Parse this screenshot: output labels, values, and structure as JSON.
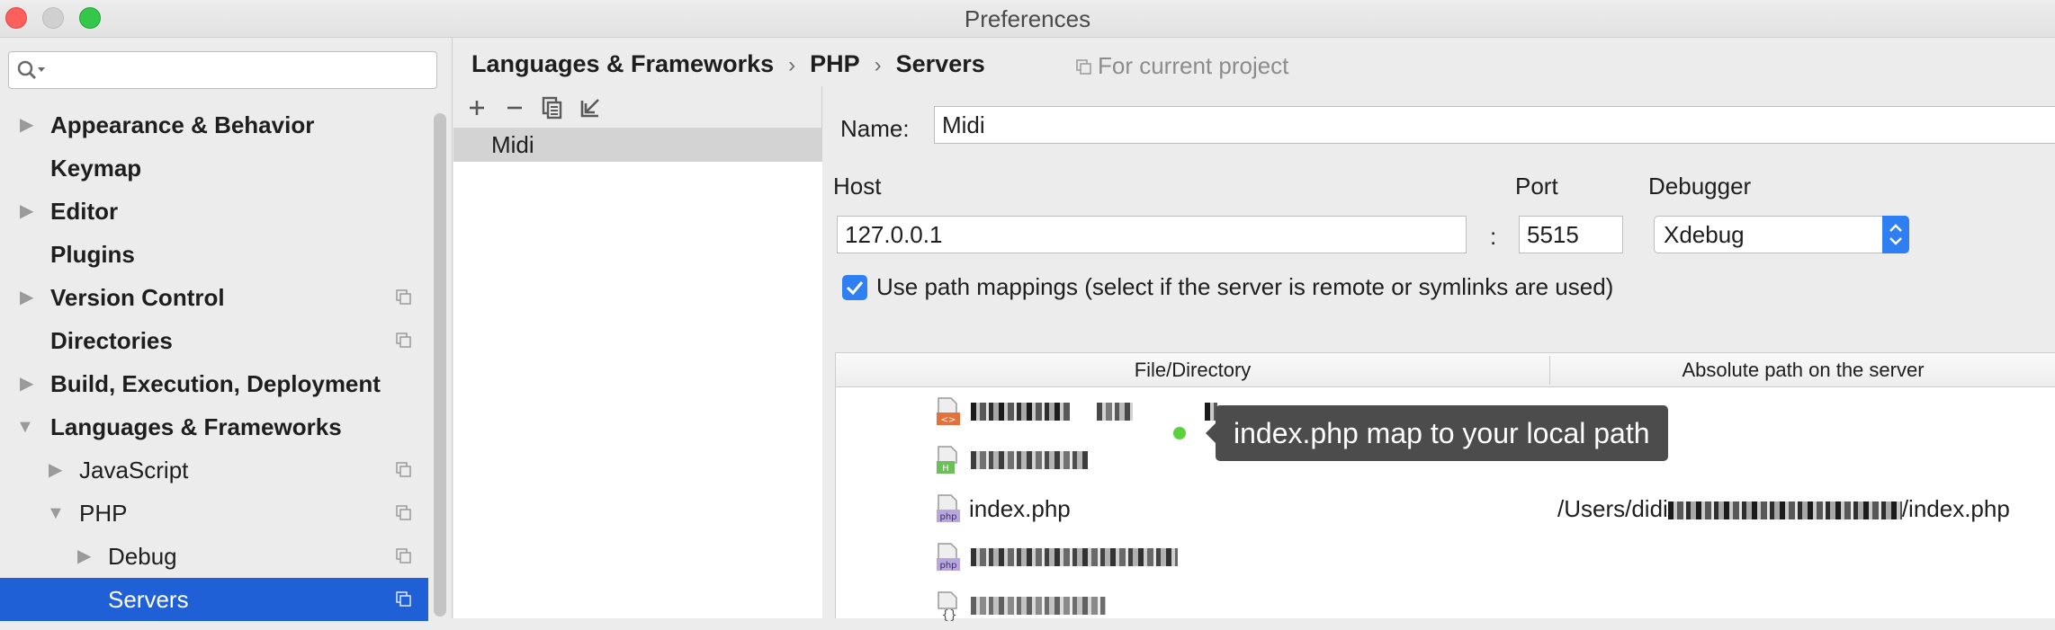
{
  "window": {
    "title": "Preferences"
  },
  "search": {
    "placeholder": ""
  },
  "sidebar": {
    "items": [
      {
        "label": "Appearance & Behavior",
        "arrow": "▶",
        "bold": true
      },
      {
        "label": "Keymap",
        "arrow": "",
        "bold": true
      },
      {
        "label": "Editor",
        "arrow": "▶",
        "bold": true
      },
      {
        "label": "Plugins",
        "arrow": "",
        "bold": true
      },
      {
        "label": "Version Control",
        "arrow": "▶",
        "bold": true,
        "project": true
      },
      {
        "label": "Directories",
        "arrow": "",
        "bold": true,
        "project": true
      },
      {
        "label": "Build, Execution, Deployment",
        "arrow": "▶",
        "bold": true
      },
      {
        "label": "Languages & Frameworks",
        "arrow": "▼",
        "bold": true
      },
      {
        "label": "JavaScript",
        "arrow": "▶",
        "bold": false,
        "project": true
      },
      {
        "label": "PHP",
        "arrow": "▼",
        "bold": false,
        "project": true
      },
      {
        "label": "Debug",
        "arrow": "▶",
        "bold": false,
        "project": true
      },
      {
        "label": "Servers",
        "arrow": "",
        "bold": false,
        "project": true,
        "selected": true
      }
    ]
  },
  "breadcrumb": {
    "part1": "Languages & Frameworks",
    "sep": "›",
    "part2": "PHP",
    "part3": "Servers"
  },
  "scope": {
    "label": "For current project"
  },
  "servers": {
    "items": [
      "Midi"
    ]
  },
  "form": {
    "name_label": "Name:",
    "name_value": "Midi",
    "host_label": "Host",
    "host_value": "127.0.0.1",
    "colon": ":",
    "port_label": "Port",
    "port_value": "5515",
    "debugger_label": "Debugger",
    "debugger_value": "Xdebug",
    "path_mappings_label": "Use path mappings (select if the server is remote or symlinks are used)",
    "path_mappings_checked": true
  },
  "mappings": {
    "col_file": "File/Directory",
    "col_server": "Absolute path on the server",
    "rows": [
      {
        "icon": "html-file-icon",
        "name": "",
        "server_path": ""
      },
      {
        "icon": "h-file-icon",
        "name": "",
        "server_path": ""
      },
      {
        "icon": "php-file-icon",
        "name": "index.php",
        "server_path_prefix": "/Users/didi",
        "server_path_suffix": "/index.php"
      },
      {
        "icon": "php-file-icon",
        "name": "",
        "server_path": ""
      },
      {
        "icon": "json-file-icon",
        "name": "",
        "server_path": ""
      }
    ]
  },
  "tooltip": {
    "text": "index.php map to your local path"
  },
  "colors": {
    "accent": "#2f7ff2",
    "selection": "#2060d6",
    "tooltip_bg": "#4c4c4c"
  }
}
